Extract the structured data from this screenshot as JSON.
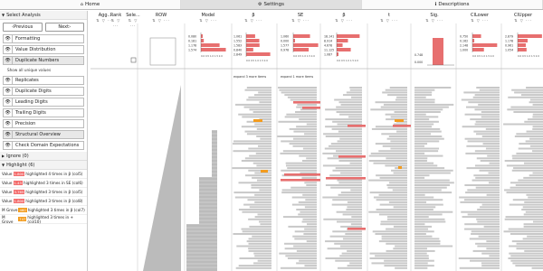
{
  "tabs": [
    {
      "icon": "⌂",
      "label": "Home"
    },
    {
      "icon": "⚙",
      "label": "Settings"
    },
    {
      "icon": "ℹ",
      "label": "Descriptions"
    }
  ],
  "sidebar": {
    "select_analysis": "Select Analysis",
    "prev": "Previous",
    "next": "Next",
    "items_a": [
      "Formatting",
      "Value Distribution",
      "Duplicate Numbers"
    ],
    "show_all": "Show all unique values",
    "items_b": [
      "Replicates",
      "Duplicate Digits",
      "Leading Digits",
      "Trailing Digits",
      "Precision",
      "Structural Overview",
      "Check Domain Expectations"
    ],
    "ignore": "Ignore (0)",
    "highlight": "Highlight (6)",
    "highlights": [
      {
        "pre": "Value",
        "val": "1.800",
        "post": "highlighted 4 times in β (col5)",
        "color": "r"
      },
      {
        "pre": "Value",
        "val": "1.43",
        "post": "highlighted 3 times in SE (col6)",
        "color": "r"
      },
      {
        "pre": "Value",
        "val": "3.765",
        "post": "highlighted 3 times in β (col5)",
        "color": "r"
      },
      {
        "pre": "Value",
        "val": "1.800",
        "post": "highlighted 3 times in β (col8)",
        "color": "r"
      },
      {
        "pre": "M Grove",
        "val": "460",
        "post": "highlighted 3 times in β (col7)",
        "color": "o"
      },
      {
        "pre": "M Grove",
        "val": "747",
        "post": "highlighted 3 times in + (col10)",
        "color": "o"
      }
    ]
  },
  "columns": [
    "Agg...",
    "Rank",
    "Sele...",
    "ROW",
    "Model",
    "β",
    "SE",
    "β",
    "t",
    "Sig.",
    "CILower",
    "CIUpper"
  ],
  "column_icons": "⇅ ▽ ···",
  "mini": {
    "b": [
      "0.080",
      "0.181",
      "1.178",
      "1.574"
    ],
    "se": [
      "1.061",
      "1.552",
      "1.583",
      "0.840",
      "2.849"
    ],
    "b2": [
      "1.060",
      "0.000",
      "1.577",
      "0.978"
    ],
    "t": [
      "18.141",
      "8.914",
      "4.678",
      "11.125",
      "1.087"
    ],
    "sig": [
      "0.748",
      "0.000"
    ],
    "cil": [
      "0.750",
      "0.162",
      "2.148",
      "1.000"
    ],
    "ciu": [
      "2.879",
      "1.178",
      "0.961",
      "1.054"
    ]
  },
  "expand_se": "expand 3 more items",
  "expand_b2": "expand 1 more items",
  "axis": "0.0 0.5 1.0 1.5 2.0"
}
